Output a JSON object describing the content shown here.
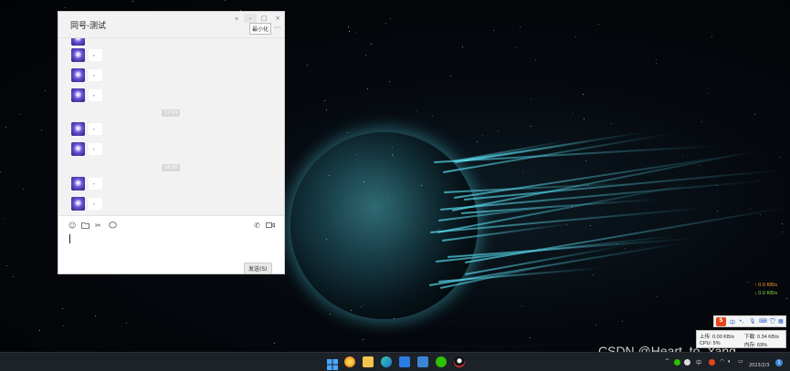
{
  "chat_window": {
    "title": "同号-测试",
    "controls": {
      "pin": "⌅",
      "minimize": "–",
      "maximize": "□",
      "close": "×"
    },
    "minimize_tooltip": "最小化",
    "more": "···",
    "messages": [
      {
        "text": ","
      },
      {
        "text": ","
      },
      {
        "text": ","
      },
      {
        "text": ","
      },
      {
        "text": ","
      },
      {
        "text": ","
      },
      {
        "text": ","
      }
    ],
    "timestamps": [
      "17:24",
      "18:00"
    ],
    "toolbar_icons": [
      "emoji-icon",
      "folder-icon",
      "scissors-icon",
      "chat-history-icon",
      "phone-icon",
      "video-icon"
    ],
    "send_label": "发送(S)"
  },
  "net_meter": {
    "up": "↑ 0.0 KB/s",
    "down": "↓ 0.0 KB/s",
    "up_color": "#ff9f2e",
    "down_color": "#8fe04a"
  },
  "ime_bar": {
    "logo": "S",
    "mode": "中"
  },
  "stats_popup": {
    "upload": "上传: 0.00 KB/s",
    "download": "下载: 0.34 KB/s",
    "cpu": "CPU: 5%",
    "memory": "内存: 69%"
  },
  "watermark": "CSDN @Heart_to_Yang",
  "taskbar": {
    "apps": [
      "windows-start-icon",
      "browser-icon",
      "file-explorer-icon",
      "edge-icon",
      "dev-tool-icon",
      "photos-icon",
      "wechat-icon",
      "qq-icon"
    ],
    "tray_lang": "中",
    "date": "2023/2/3",
    "notification_count": "1"
  }
}
